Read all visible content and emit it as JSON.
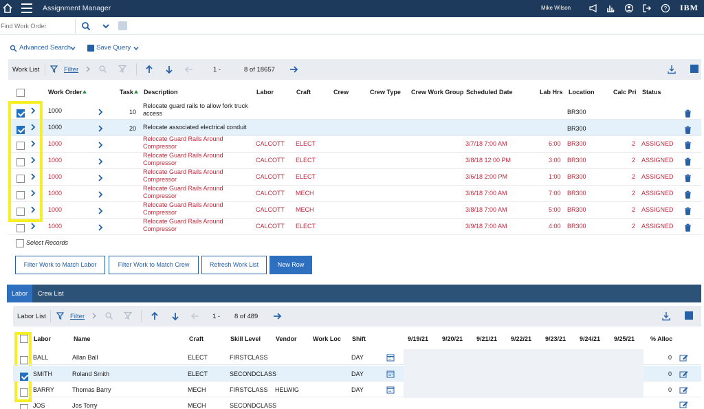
{
  "topbar": {
    "app_title": "Assignment Manager",
    "user_name": "Mike Wilson",
    "brand": "IBM"
  },
  "search": {
    "placeholder": "Find Work Order"
  },
  "query": {
    "advanced_search": "Advanced Search",
    "save_query": "Save Query"
  },
  "work_toolbar": {
    "label": "Work List",
    "filter": "Filter",
    "page_start": "1 -",
    "page_end": "8 of 18657"
  },
  "work_headers": {
    "work_order": "Work Order",
    "task": "Task",
    "description": "Description",
    "labor": "Labor",
    "craft": "Craft",
    "crew": "Crew",
    "crew_type": "Crew Type",
    "crew_work_group": "Crew Work Group",
    "scheduled_date": "Scheduled Date",
    "lab_hrs": "Lab Hrs",
    "location": "Location",
    "calc_pri": "Calc Pri",
    "status": "Status"
  },
  "work_rows": [
    {
      "work_order": "1000",
      "task": "10",
      "desc1": "Relocate guard rails to allow fork truck",
      "desc2": "access",
      "labor": "",
      "craft": "",
      "scheduled_date": "",
      "lab_hrs": "",
      "location": "BR300",
      "calc_pri": "",
      "status": ""
    },
    {
      "work_order": "1000",
      "task": "20",
      "desc1": "Relocate associated electrical conduit",
      "desc2": "",
      "labor": "",
      "craft": "",
      "scheduled_date": "",
      "lab_hrs": "",
      "location": "BR300",
      "calc_pri": "",
      "status": ""
    },
    {
      "work_order": "1000",
      "task": "",
      "desc1": "Relocate Guard Rails Around",
      "desc2": "Compressor",
      "labor": "CALCOTT",
      "craft": "ELECT",
      "scheduled_date": "3/7/18 7:00 AM",
      "lab_hrs": "6:00",
      "location": "BR300",
      "calc_pri": "2",
      "status": "ASSIGNED"
    },
    {
      "work_order": "1000",
      "task": "",
      "desc1": "Relocate Guard Rails Around",
      "desc2": "Compressor",
      "labor": "CALCOTT",
      "craft": "ELECT",
      "scheduled_date": "3/8/18 12:00 PM",
      "lab_hrs": "3:00",
      "location": "BR300",
      "calc_pri": "2",
      "status": "ASSIGNED"
    },
    {
      "work_order": "1000",
      "task": "",
      "desc1": "Relocate Guard Rails Around",
      "desc2": "Compressor",
      "labor": "CALCOTT",
      "craft": "ELECT",
      "scheduled_date": "3/6/18 2:00 PM",
      "lab_hrs": "1:00",
      "location": "BR300",
      "calc_pri": "2",
      "status": "ASSIGNED"
    },
    {
      "work_order": "1000",
      "task": "",
      "desc1": "Relocate Guard Rails Around",
      "desc2": "Compressor",
      "labor": "CALCOTT",
      "craft": "MECH",
      "scheduled_date": "3/6/18 7:00 AM",
      "lab_hrs": "7:00",
      "location": "BR300",
      "calc_pri": "2",
      "status": "ASSIGNED"
    },
    {
      "work_order": "1000",
      "task": "",
      "desc1": "Relocate Guard Rails Around",
      "desc2": "Compressor",
      "labor": "CALCOTT",
      "craft": "MECH",
      "scheduled_date": "3/8/18 7:00 AM",
      "lab_hrs": "5:00",
      "location": "BR300",
      "calc_pri": "2",
      "status": "ASSIGNED"
    },
    {
      "work_order": "1000",
      "task": "",
      "desc1": "Relocate Guard Rails Around",
      "desc2": "Compressor",
      "labor": "CALCOTT",
      "craft": "ELECT",
      "scheduled_date": "3/9/18 7:00 AM",
      "lab_hrs": "4:00",
      "location": "BR300",
      "calc_pri": "2",
      "status": "ASSIGNED"
    }
  ],
  "work_checked": [
    true,
    true,
    false,
    false,
    false,
    false,
    false,
    false
  ],
  "select_records": "Select Records",
  "buttons": {
    "filter_labor": "Filter Work to Match Labor",
    "filter_crew": "Filter Work to Match Crew",
    "refresh": "Refresh Work List",
    "new_row": "New Row"
  },
  "tabs": {
    "labor": "Labor",
    "crew_list": "Crew List"
  },
  "labor_toolbar": {
    "label": "Labor List",
    "filter": "Filter",
    "page_start": "1 -",
    "page_end": "8 of 489"
  },
  "labor_headers": {
    "labor": "Labor",
    "name": "Name",
    "craft": "Craft",
    "skill_level": "Skill Level",
    "vendor": "Vendor",
    "work_loc": "Work Loc",
    "shift": "Shift",
    "dates": [
      "9/19/21",
      "9/20/21",
      "9/21/21",
      "9/22/21",
      "9/23/21",
      "9/24/21",
      "9/25/21"
    ],
    "pct_alloc": "% Alloc"
  },
  "labor_rows": [
    {
      "labor": "BALL",
      "name": "Allan Ball",
      "craft": "ELECT",
      "skill": "FIRSTCLASS",
      "vendor": "",
      "shift": "DAY",
      "alloc": "0"
    },
    {
      "labor": "SMITH",
      "name": "Roland Smith",
      "craft": "ELECT",
      "skill": "SECONDCLASS",
      "vendor": "",
      "shift": "DAY",
      "alloc": "0"
    },
    {
      "labor": "BARRY",
      "name": "Thomas Barry",
      "craft": "MECH",
      "skill": "FIRSTCLASS",
      "vendor": "HELWIG",
      "shift": "DAY",
      "alloc": "0"
    },
    {
      "labor": "JOS",
      "name": "Jos Torry",
      "craft": "MECH",
      "skill": "SECONDCLASS",
      "vendor": "",
      "shift": "",
      "alloc": ""
    }
  ],
  "labor_checked": [
    false,
    true,
    false,
    false
  ],
  "colors": {
    "topbar": "#1d3a5c",
    "link": "#2661a8",
    "assigned_red": "#c0283c",
    "highlight": "#f7ef24",
    "primary": "#2f6fbf"
  }
}
